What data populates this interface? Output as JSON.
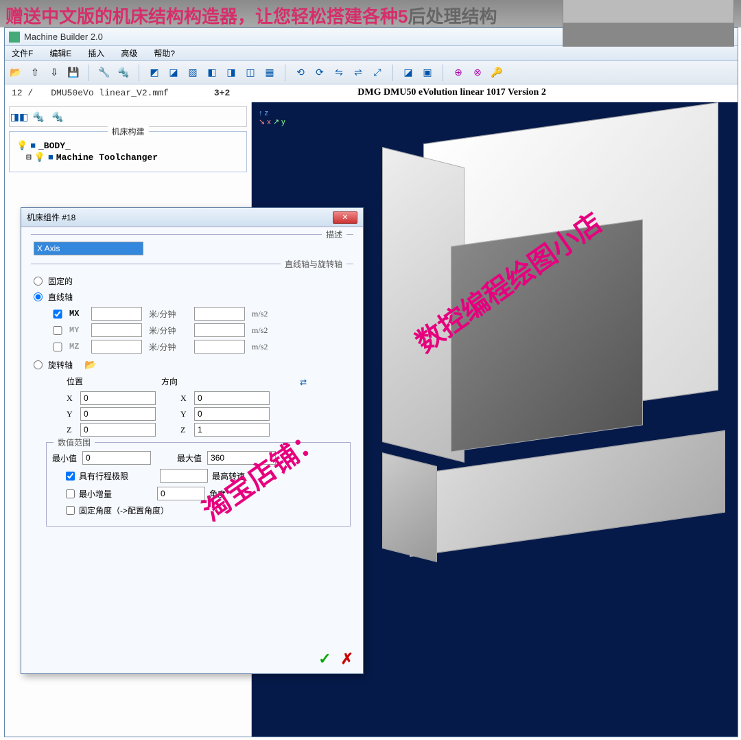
{
  "banner": {
    "text_red": "赠送中文版的机床结构构造器，让您轻松搭建各种5",
    "text_gray": "后处理结构"
  },
  "app": {
    "title": "Machine Builder 2.0",
    "menu": [
      "文件F",
      "编辑E",
      "插入",
      "高级",
      "帮助?"
    ],
    "fileinfo_left": "12 /",
    "filename": "DMU50eVo linear_V2.mmf",
    "mode": "3+2",
    "model_label": "DMG DMU50 eVolution linear 1017 Version 2"
  },
  "sidepanel": {
    "fieldset_label": "机床构建",
    "tree": {
      "body": "_BODY_",
      "toolchanger": "Machine Toolchanger"
    }
  },
  "dialog": {
    "title": "机床组件 #18",
    "section_desc": "描述",
    "desc_value": "X Axis",
    "section_axis": "直线轴与旋转轴",
    "opt_fixed": "固定的",
    "opt_linear": "直线轴",
    "axis_mx": "MX",
    "axis_my": "MY",
    "axis_mz": "MZ",
    "unit_speed": "米/分钟",
    "unit_accel": "m/s2",
    "opt_rotary": "旋转轴",
    "hdr_position": "位置",
    "hdr_direction": "方向",
    "lbl_x": "X",
    "lbl_y": "Y",
    "lbl_z": "Z",
    "pos_x": "0",
    "pos_y": "0",
    "pos_z": "0",
    "dir_x": "0",
    "dir_y": "0",
    "dir_z": "1",
    "section_range": "数值范围",
    "lbl_min": "最小值",
    "val_min": "0",
    "lbl_max": "最大值",
    "val_max": "360",
    "chk_travel": "具有行程极限",
    "lbl_maxrpm": "最高转速",
    "chk_mininc": "最小增量",
    "lbl_angle": "角度",
    "val_angle": "0",
    "chk_fixedangle": "固定角度（->配置角度）"
  },
  "watermark": {
    "line1": "数控编程绘图小店",
    "line2": "淘宝店铺："
  }
}
